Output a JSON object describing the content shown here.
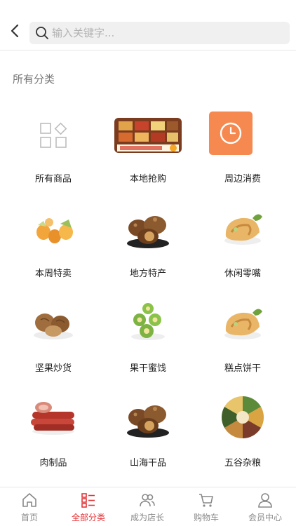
{
  "search": {
    "placeholder": "输入关键字..."
  },
  "section": {
    "title": "所有分类"
  },
  "categories": [
    {
      "label": "所有商品",
      "icon": "grid-icon"
    },
    {
      "label": "本地抢购",
      "icon": "food-platter-image"
    },
    {
      "label": "周边消费",
      "icon": "clock-icon"
    },
    {
      "label": "本周特卖",
      "icon": "fruit-image"
    },
    {
      "label": "地方特产",
      "icon": "mushroom-image"
    },
    {
      "label": "休闲零嘴",
      "icon": "pastry-image"
    },
    {
      "label": "坚果炒货",
      "icon": "walnut-image"
    },
    {
      "label": "果干蜜饯",
      "icon": "kiwi-image"
    },
    {
      "label": "糕点饼干",
      "icon": "pastry-image"
    },
    {
      "label": "肉制品",
      "icon": "sausage-image"
    },
    {
      "label": "山海干品",
      "icon": "mushroom-image"
    },
    {
      "label": "五谷杂粮",
      "icon": "grains-image"
    }
  ],
  "tabs": [
    {
      "label": "首页",
      "icon": "home-icon",
      "active": false
    },
    {
      "label": "全部分类",
      "icon": "category-list-icon",
      "active": true
    },
    {
      "label": "成为店长",
      "icon": "users-icon",
      "active": false
    },
    {
      "label": "购物车",
      "icon": "cart-icon",
      "active": false
    },
    {
      "label": "会员中心",
      "icon": "user-icon",
      "active": false
    }
  ],
  "colors": {
    "accent": "#e3363a",
    "orange_tile": "#f5894f"
  }
}
